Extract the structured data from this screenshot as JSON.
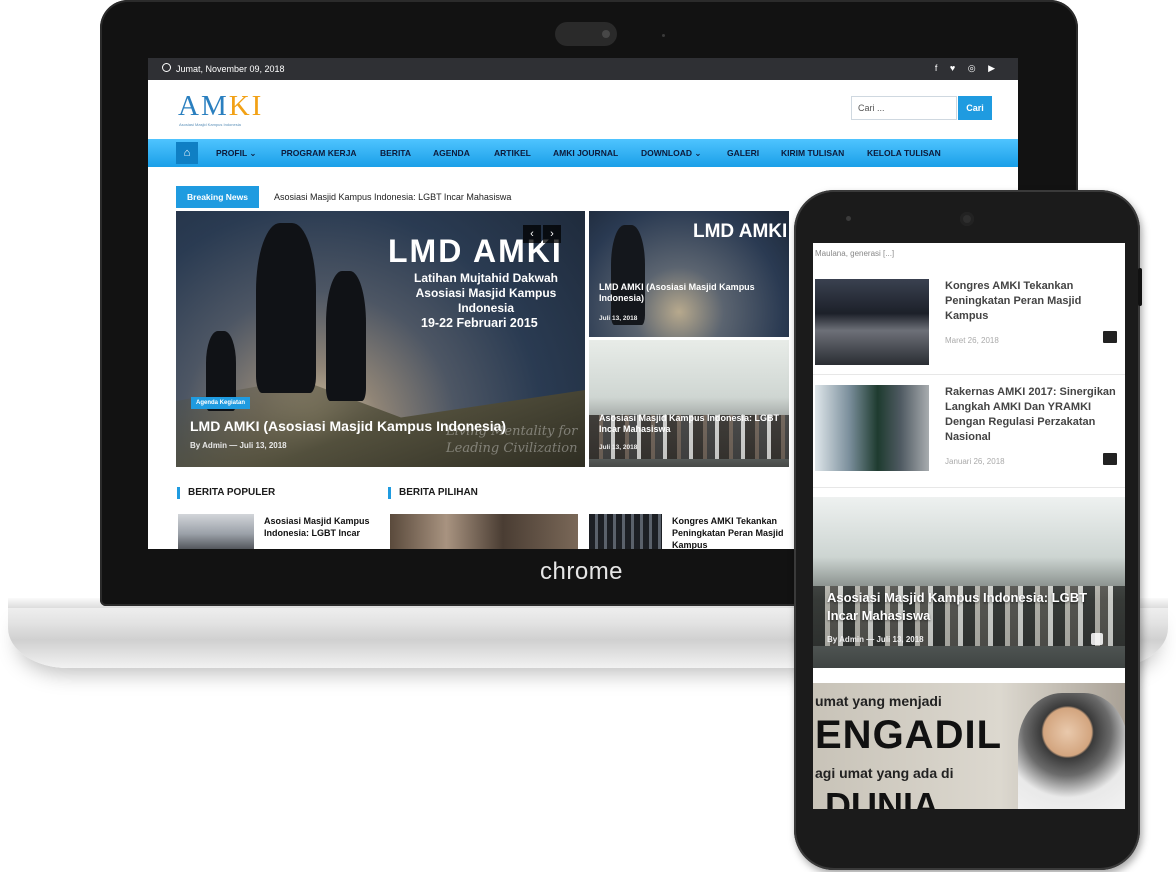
{
  "laptop": {
    "brand": "chrome",
    "topbar": {
      "date": "Jumat, November 09, 2018",
      "social_icons": "f ♥ ◎ ▶"
    },
    "header": {
      "logo_text_a": "AM",
      "logo_text_b": "KI",
      "logo_sub": "Asosiasi Masjid Kampus Indonesia",
      "search_placeholder": "Cari ...",
      "search_button": "Cari"
    },
    "nav": {
      "home_icon": "⌂",
      "items": [
        "PROFIL  ⌄",
        "PROGRAM KERJA",
        "BERITA",
        "AGENDA",
        "ARTIKEL",
        "AMKI JOURNAL",
        "DOWNLOAD  ⌄",
        "GALERI",
        "KIRIM TULISAN",
        "KELOLA TULISAN"
      ]
    },
    "breaking": {
      "label": "Breaking News",
      "text": "Asosiasi Masjid Kampus Indonesia: LGBT Incar Mahasiswa"
    },
    "hero": {
      "line1": "LMD AMKI",
      "line2": "Latihan Mujtahid Dakwah\nAsosiasi Masjid Kampus Indonesia",
      "line3": "19-22 Februari 2015",
      "prev": "‹",
      "next": "›",
      "tag": "Agenda Kegiatan",
      "title": "LMD AMKI (Asosiasi Masjid Kampus Indonesia)",
      "meta": "By Admin  —  Juli 13, 2018",
      "script": "Living Mentality for\nLeading Civilization"
    },
    "cards": [
      {
        "big": "LMD AMKI",
        "title": "LMD AMKI (Asosiasi Masjid Kampus Indonesia)",
        "date": "Juli 13, 2018"
      },
      {
        "title": "Asosiasi Masjid Kampus Indonesia: LGBT Incar Mahasiswa",
        "date": "Juli 13, 2018"
      }
    ],
    "sections": {
      "populer": "BERITA POPULER",
      "pilihan": "BERITA PILIHAN",
      "populer_item": "Asosiasi Masjid Kampus Indonesia: LGBT Incar",
      "pilihan_item": "Kongres AMKI Tekankan Peningkatan Peran Masjid Kampus"
    }
  },
  "phone": {
    "top_excerpt": "Maulana, generasi [...]",
    "items": [
      {
        "title": "Kongres AMKI Tekankan Peningkatan Peran Masjid Kampus",
        "date": "Maret 26, 2018"
      },
      {
        "title": "Rakernas AMKI 2017: Sinergikan Langkah AMKI Dan YRAMKI Dengan Regulasi Perzakatan Nasional",
        "date": "Januari 26, 2018"
      }
    ],
    "feature": {
      "title": "Asosiasi Masjid Kampus Indonesia: LGBT Incar Mahasiswa",
      "meta": "By Admin  —  Juli 13, 2018"
    },
    "video": {
      "l1": "umat yang menjadi",
      "l2": "ENGADIL",
      "l3": "agi umat yang ada di",
      "l4": "DUNIA"
    }
  }
}
